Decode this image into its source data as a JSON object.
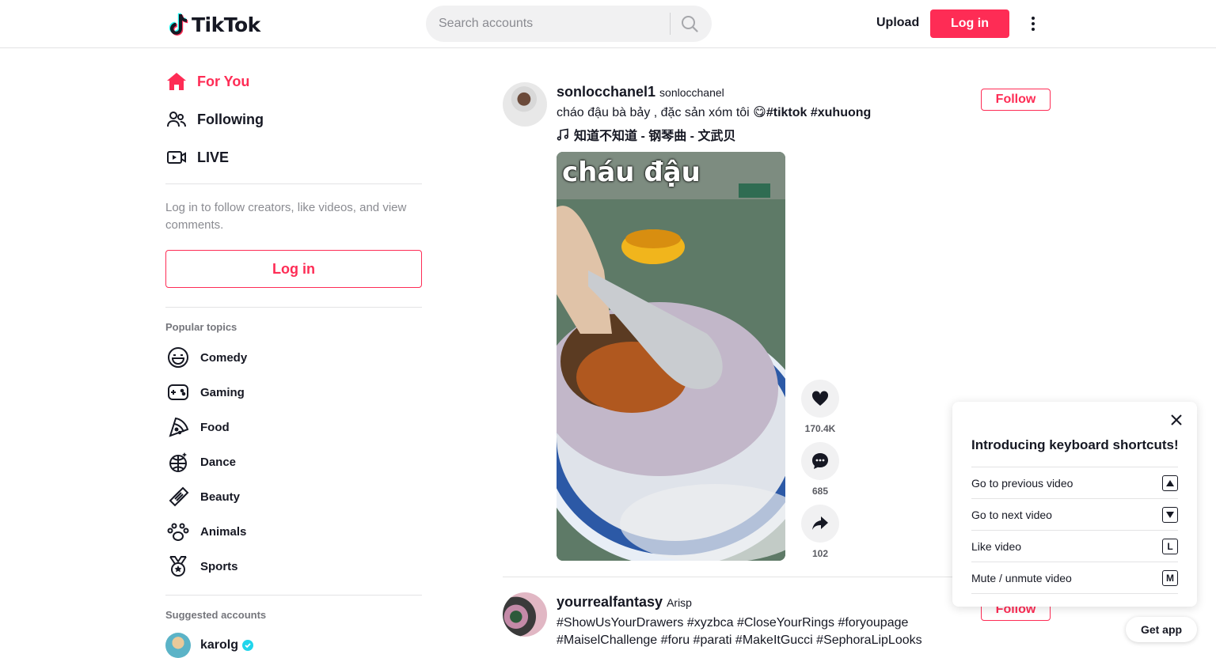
{
  "header": {
    "logo_text": "TikTok",
    "search_placeholder": "Search accounts",
    "upload_label": "Upload",
    "login_label": "Log in"
  },
  "sidebar": {
    "nav": [
      {
        "label": "For You",
        "icon": "home-icon",
        "active": true
      },
      {
        "label": "Following",
        "icon": "users-icon",
        "active": false
      },
      {
        "label": "LIVE",
        "icon": "live-icon",
        "active": false
      }
    ],
    "login_hint": "Log in to follow creators, like videos, and view comments.",
    "login_button": "Log in",
    "popular_topics_title": "Popular topics",
    "topics": [
      {
        "label": "Comedy",
        "icon": "smile-icon"
      },
      {
        "label": "Gaming",
        "icon": "gamepad-icon"
      },
      {
        "label": "Food",
        "icon": "pizza-icon"
      },
      {
        "label": "Dance",
        "icon": "disco-ball-icon"
      },
      {
        "label": "Beauty",
        "icon": "comb-icon"
      },
      {
        "label": "Animals",
        "icon": "paw-icon"
      },
      {
        "label": "Sports",
        "icon": "medal-icon"
      }
    ],
    "suggested_title": "Suggested accounts",
    "suggested": [
      {
        "name": "karolg",
        "verified": true
      }
    ]
  },
  "feed": {
    "posts": [
      {
        "author": "sonlocchanel1",
        "nickname": "sonlocchanel",
        "caption_text": "cháo đậu bà bảy , đặc sản xóm tôi 😋",
        "caption_tags": "#tiktok #xuhuong",
        "music": "知道不知道 - 钢琴曲 - 文武贝",
        "follow_label": "Follow",
        "video_overlay": "cháu đậu",
        "likes": "170.4K",
        "comments": "685",
        "shares": "102"
      },
      {
        "author": "yourrealfantasy",
        "nickname": "Arisp",
        "caption_line1": "#ShowUsYourDrawers #xyzbca #CloseYourRings #foryoupage",
        "caption_line2": "#MaiselChallenge #foru #parati #MakeItGucci #SephoraLipLooks",
        "follow_label": "Follow"
      }
    ]
  },
  "shortcuts": {
    "title": "Introducing keyboard shortcuts!",
    "items": [
      {
        "label": "Go to previous video",
        "key": "▲"
      },
      {
        "label": "Go to next video",
        "key": "▼"
      },
      {
        "label": "Like video",
        "key": "L"
      },
      {
        "label": "Mute / unmute video",
        "key": "M"
      }
    ]
  },
  "get_app_label": "Get app",
  "colors": {
    "accent": "#fe2c55",
    "text": "#161823",
    "muted": "#8a8b91",
    "verified": "#20d5ec"
  }
}
